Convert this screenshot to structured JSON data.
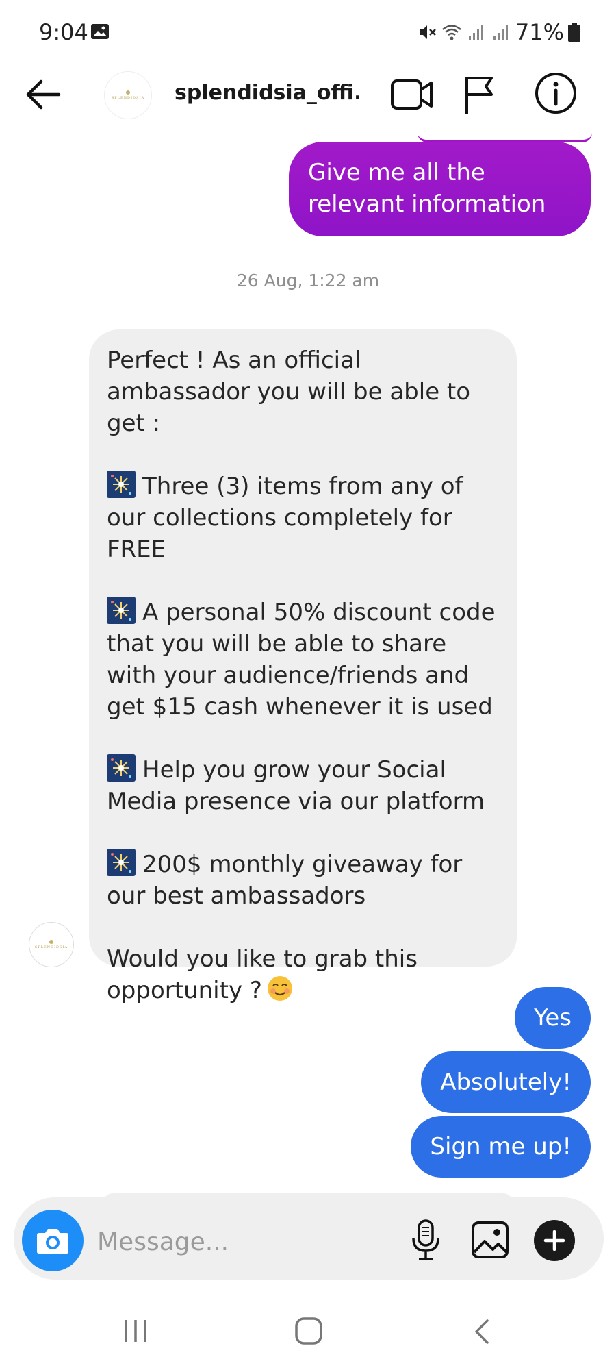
{
  "status_bar": {
    "time": "9:04",
    "battery": "71%",
    "icons": [
      "gallery-icon",
      "mute-icon",
      "wifi-icon",
      "signal-icon",
      "signal-icon",
      "battery-icon"
    ]
  },
  "header": {
    "contact_name": "splendidsia_offi...",
    "avatar_logo_text": "SPLENDIDSIA"
  },
  "conversation": {
    "outgoing_top": "Give me all the relevant information",
    "timestamp": "26 Aug, 1:22 am",
    "incoming": {
      "intro": "Perfect ! As an official ambassador you will be able to get :",
      "items": [
        "Three (3) items from any of our collections completely for FREE",
        "A personal 50% discount code that you will be able to share with your audience/friends and get $15 cash whenever it is used",
        "Help you grow your Social Media presence  via our platform",
        "200$ monthly giveaway for our best ambassadors"
      ],
      "closing": "Would you like to grab this opportunity ?"
    },
    "replies": [
      "Yes",
      "Absolutely!",
      "Sign me up!"
    ]
  },
  "composer": {
    "placeholder": "Message..."
  },
  "colors": {
    "outgoing_purple": "#9a16c8",
    "outgoing_blue": "#2d6fe6",
    "incoming_gray": "#efefef",
    "camera_blue": "#1d8ef7"
  }
}
